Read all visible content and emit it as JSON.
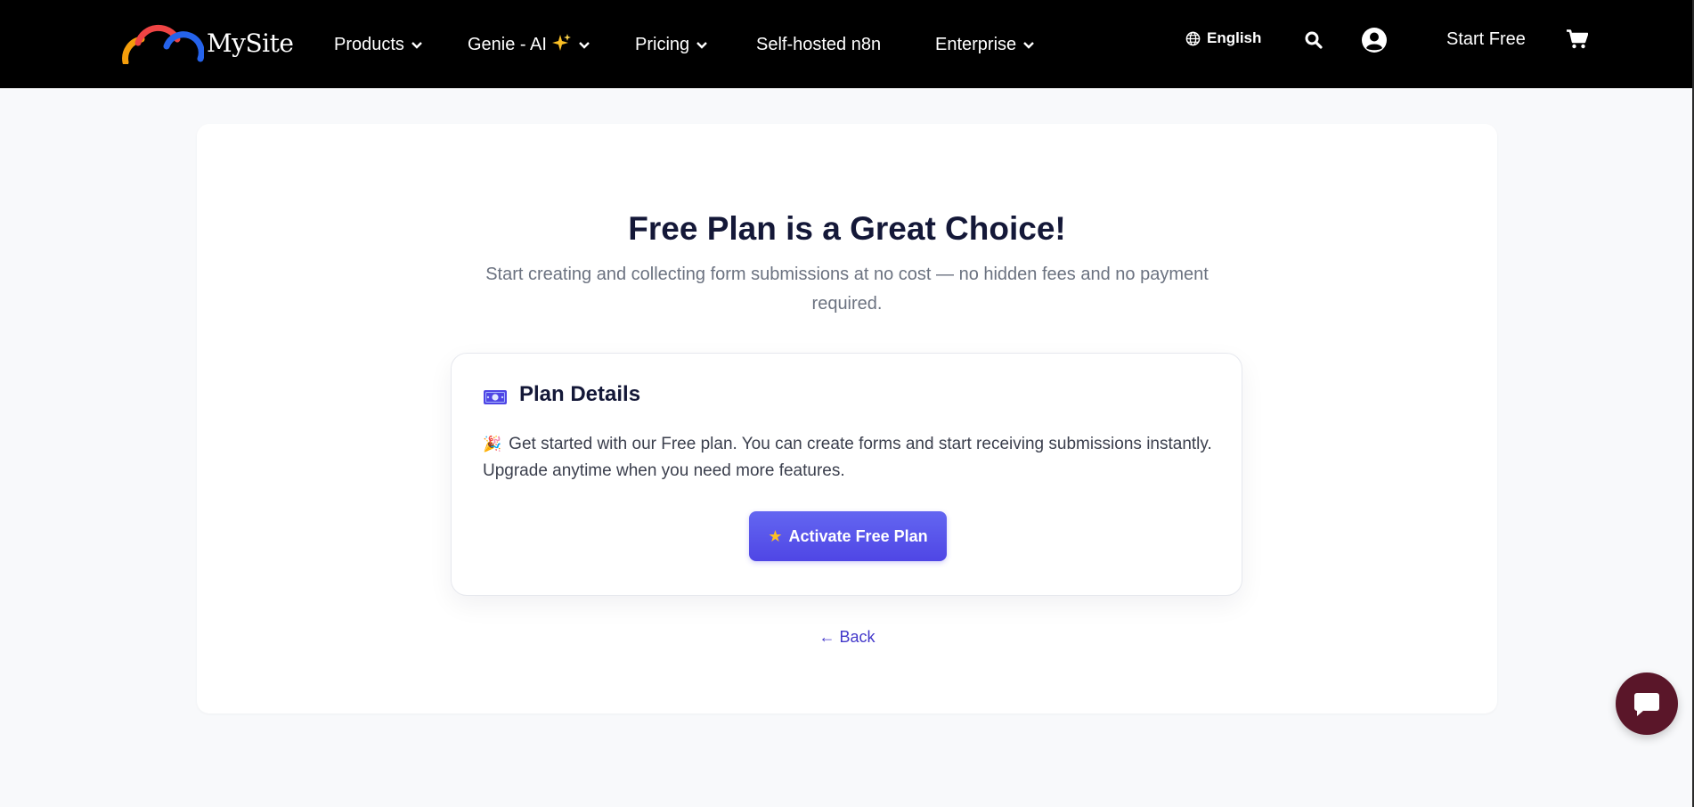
{
  "header": {
    "logo_text": "MySite",
    "nav": [
      {
        "label": "Products",
        "has_dropdown": true
      },
      {
        "label": "Genie - AI",
        "has_dropdown": true,
        "icon": "sparkle-icon"
      },
      {
        "label": "Pricing",
        "has_dropdown": true
      },
      {
        "label": "Self-hosted n8n",
        "has_dropdown": false
      },
      {
        "label": "Enterprise",
        "has_dropdown": true
      }
    ],
    "language": "English",
    "start_free_label": "Start Free"
  },
  "main": {
    "title": "Free Plan is a Great Choice!",
    "subtitle": "Start creating and collecting form submissions at no cost — no hidden fees and no payment required.",
    "plan": {
      "title": "Plan Details",
      "description": "Get started with our Free plan. You can create forms and start receiving submissions instantly. Upgrade anytime when you need more features.",
      "activate_label": "Activate Free Plan"
    },
    "back_label": "← Back"
  },
  "colors": {
    "header_bg": "#000000",
    "page_bg": "#f8f9fb",
    "accent": "#4f46e5",
    "title": "#141838",
    "chat_bubble": "#5a1629"
  }
}
